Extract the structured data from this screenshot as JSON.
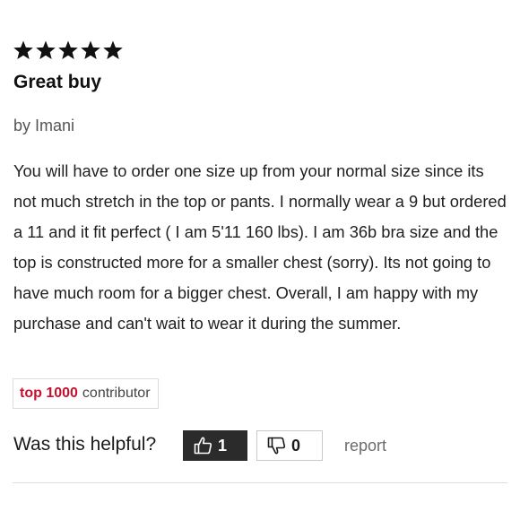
{
  "review": {
    "rating": 5,
    "rating_max": 5,
    "title": "Great buy",
    "author_line": "by Imani",
    "body": "You will have to order one size up from your normal size since its not much stretch in the top or pants. I normally wear a 9 but ordered a 11 and it fit perfect ( I am 5'11 160 lbs). I am 36b bra size and the top is constructed more for a smaller chest (sorry). Its not going to have much room for a bigger chest. Overall, I am happy with my purchase and can't wait to wear it during the summer.",
    "badge": {
      "rank": "top 1000",
      "label": "contributor",
      "rank_color": "#c8102e"
    }
  },
  "helpful": {
    "question": "Was this helpful?",
    "up_icon": "thumbs-up-icon",
    "up_count": "1",
    "down_icon": "thumbs-down-icon",
    "down_count": "0",
    "report_label": "report"
  },
  "star_icon": "star-icon",
  "star_color": "#111111"
}
